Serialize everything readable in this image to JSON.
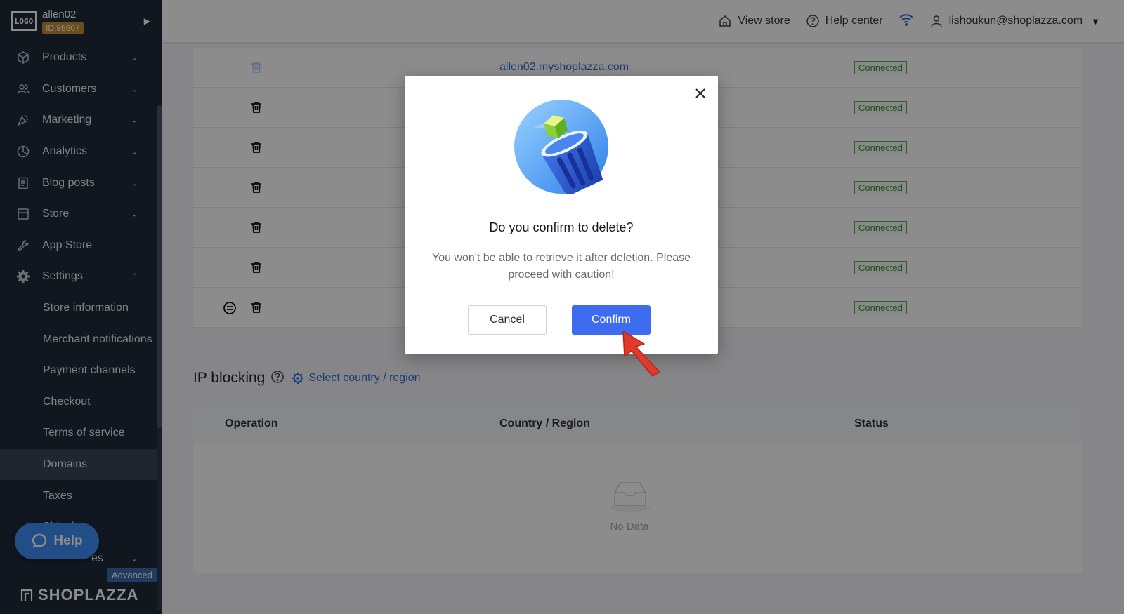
{
  "sidebar": {
    "logo_text": "LOGO",
    "store_name": "allen02",
    "store_id": "ID:95607",
    "nav_items": [
      {
        "label": "Products",
        "icon": "box-icon"
      },
      {
        "label": "Customers",
        "icon": "users-icon"
      },
      {
        "label": "Marketing",
        "icon": "megaphone-icon"
      },
      {
        "label": "Analytics",
        "icon": "pie-chart-icon"
      },
      {
        "label": "Blog posts",
        "icon": "document-icon"
      },
      {
        "label": "Store",
        "icon": "store-icon"
      },
      {
        "label": "App Store",
        "icon": "wrench-icon"
      },
      {
        "label": "Settings",
        "icon": "gear-icon"
      }
    ],
    "settings_sub": [
      {
        "label": "Store information"
      },
      {
        "label": "Merchant notifications"
      },
      {
        "label": "Payment channels"
      },
      {
        "label": "Checkout"
      },
      {
        "label": "Terms of service"
      },
      {
        "label": "Domains",
        "active": true
      },
      {
        "label": "Taxes"
      },
      {
        "label": "Shipping"
      }
    ],
    "partial_item": "es",
    "help_label": "Help",
    "advanced_label": "Advanced",
    "brand_text": "SHOPLAZZA"
  },
  "topbar": {
    "view_store": "View store",
    "help_center": "Help center",
    "user_email": "lishoukun@shoplazza.com"
  },
  "domains": {
    "rows": [
      {
        "domain": "allen02.myshoplazza.com",
        "status": "Connected",
        "faded_trash": true,
        "unlink": false
      },
      {
        "domain": "",
        "status": "Connected",
        "faded_trash": false,
        "unlink": false
      },
      {
        "domain": "",
        "status": "Connected",
        "faded_trash": false,
        "unlink": false
      },
      {
        "domain": "",
        "status": "Connected",
        "faded_trash": false,
        "unlink": false
      },
      {
        "domain": "",
        "status": "Connected",
        "faded_trash": false,
        "unlink": false
      },
      {
        "domain": "",
        "status": "Connected",
        "faded_trash": false,
        "unlink": false
      },
      {
        "domain": "",
        "status": "Connected",
        "faded_trash": false,
        "unlink": true
      }
    ]
  },
  "ip_blocking": {
    "title": "IP blocking",
    "select_label": "Select country / region",
    "columns": [
      "Operation",
      "Country / Region",
      "Status"
    ],
    "empty_text": "No Data"
  },
  "modal": {
    "title": "Do you confirm to delete?",
    "message": "You won't be able to retrieve it after deletion. Please proceed with caution!",
    "cancel_label": "Cancel",
    "confirm_label": "Confirm"
  },
  "colors": {
    "sidebar_bg": "#1f2a3a",
    "accent_blue": "#3d6cf0",
    "link_blue": "#2f6fd6",
    "status_green": "#3e8a3e",
    "annotation_red": "#e03a2c"
  }
}
